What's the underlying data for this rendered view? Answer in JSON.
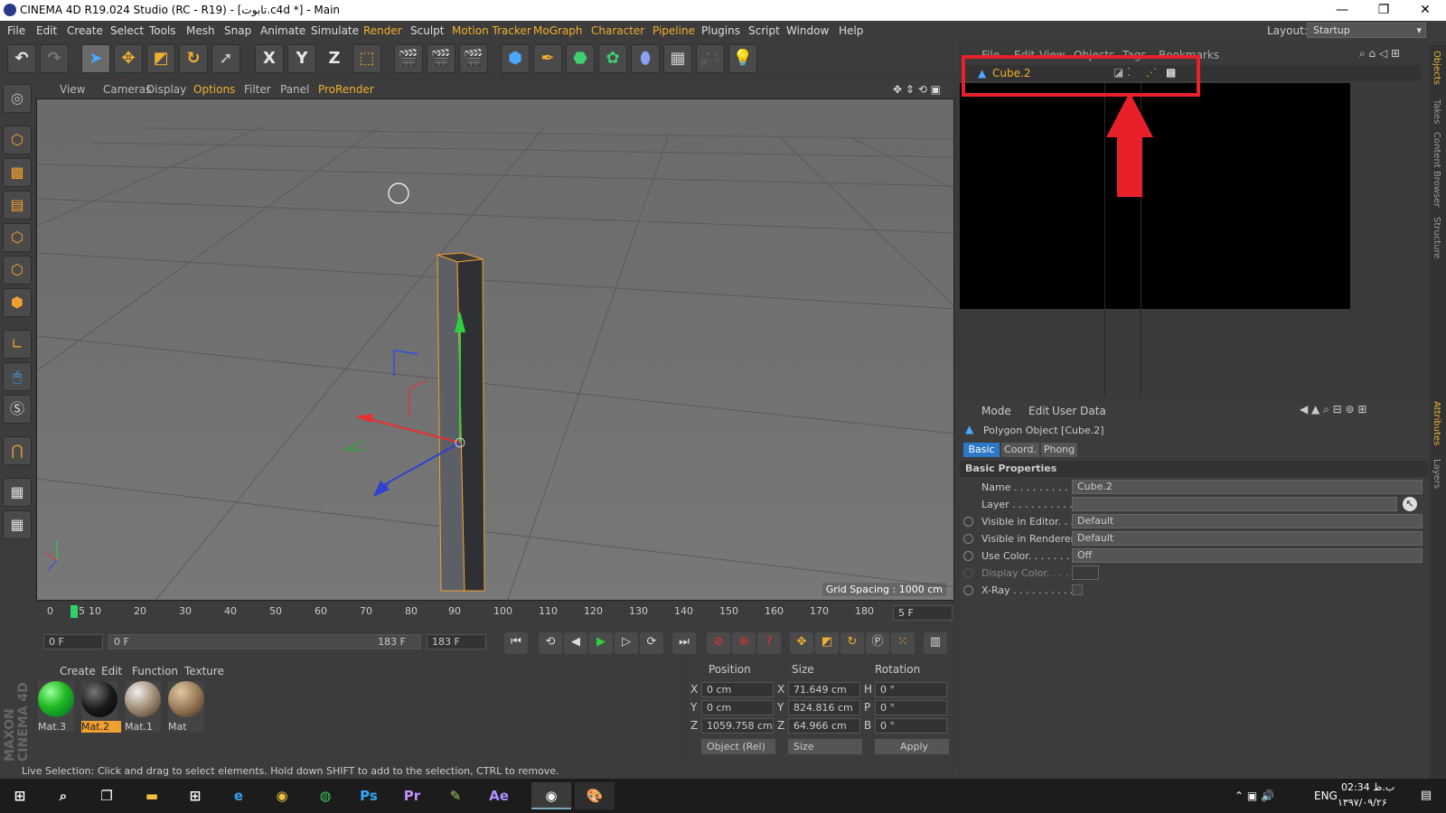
{
  "window": {
    "title": "CINEMA 4D R19.024 Studio (RC - R19) - [تابوت.c4d *] - Main",
    "minimize": "—",
    "maximize": "❐",
    "close": "✕"
  },
  "menubar": {
    "items": [
      "File",
      "Edit",
      "Create",
      "Select",
      "Tools",
      "Mesh",
      "Snap",
      "Animate",
      "Simulate",
      "Render",
      "Sculpt",
      "Motion Tracker",
      "MoGraph",
      "Character",
      "Pipeline",
      "Plugins",
      "Script",
      "Window",
      "Help"
    ],
    "layout_label": "Layout:",
    "layout_value": "Startup"
  },
  "toolbar": {
    "x_label": "X",
    "y_label": "Y",
    "z_label": "Z"
  },
  "viewport": {
    "menu": [
      "View",
      "Cameras",
      "Display",
      "Options",
      "Filter",
      "Panel",
      "ProRender"
    ],
    "grid_spacing": "Grid Spacing : 1000 cm"
  },
  "timeline": {
    "ticks": [
      "0",
      "5",
      "10",
      "20",
      "30",
      "40",
      "50",
      "60",
      "70",
      "80",
      "90",
      "100",
      "110",
      "120",
      "130",
      "140",
      "150",
      "160",
      "170",
      "180"
    ],
    "end_field": "5 F"
  },
  "transport": {
    "current_frame": "0 F",
    "range_start": "0 F",
    "range_end": "183 F",
    "max_frame": "183 F"
  },
  "materials": {
    "menu": [
      "Create",
      "Edit",
      "Function",
      "Texture"
    ],
    "items": [
      {
        "name": "Mat.3",
        "color": "#1fb81f"
      },
      {
        "name": "Mat.2",
        "color": "#1a1a1a"
      },
      {
        "name": "Mat.1",
        "color": "#a08c74"
      },
      {
        "name": "Mat",
        "color": "#9a7a58"
      }
    ],
    "selected": "Mat.2",
    "brand_line1": "MAXON",
    "brand_line2": "CINEMA 4D"
  },
  "coords": {
    "headers": [
      "Position",
      "Size",
      "Rotation"
    ],
    "rows": [
      {
        "axis": "X",
        "pos": "0 cm",
        "saxis": "X",
        "size": "71.649 cm",
        "raxis": "H",
        "rot": "0 °"
      },
      {
        "axis": "Y",
        "pos": "0 cm",
        "saxis": "Y",
        "size": "824.816 cm",
        "raxis": "P",
        "rot": "0 °"
      },
      {
        "axis": "Z",
        "pos": "1059.758 cm",
        "saxis": "Z",
        "size": "64.966 cm",
        "raxis": "B",
        "rot": "0 °"
      }
    ],
    "mode": "Object (Rel)",
    "size_mode": "Size",
    "apply": "Apply"
  },
  "statusbar": {
    "text": "Live Selection: Click and drag to select elements. Hold down SHIFT to add to the selection, CTRL to remove."
  },
  "objects": {
    "menu": [
      "File",
      "Edit",
      "View",
      "Objects",
      "Tags",
      "Bookmarks"
    ],
    "item": "Cube.2"
  },
  "attributes": {
    "menu": [
      "Mode",
      "Edit",
      "User Data"
    ],
    "object_title": "Polygon Object [Cube.2]",
    "tabs": [
      "Basic",
      "Coord.",
      "Phong"
    ],
    "section": "Basic Properties",
    "rows": [
      {
        "label": "Name . . . . . . . . . . .",
        "value": "Cube.2"
      },
      {
        "label": "Layer . . . . . . . . . . .",
        "value": ""
      },
      {
        "label": "Visible in Editor. . .",
        "value": "Default"
      },
      {
        "label": "Visible in Renderer",
        "value": "Default"
      },
      {
        "label": "Use Color. . . . . . . .",
        "value": "Off"
      },
      {
        "label": "Display Color. . . .",
        "value": ""
      },
      {
        "label": "X-Ray . . . . . . . . . .",
        "value": ""
      }
    ]
  },
  "side_tabs": [
    "Objects",
    "Takes",
    "Content Browser",
    "Structure",
    "Attributes",
    "Layers"
  ],
  "taskbar": {
    "lang": "ENG",
    "time": "02:34 ب.ظ",
    "date": "۱۳۹۷/۰۹/۲۶"
  }
}
